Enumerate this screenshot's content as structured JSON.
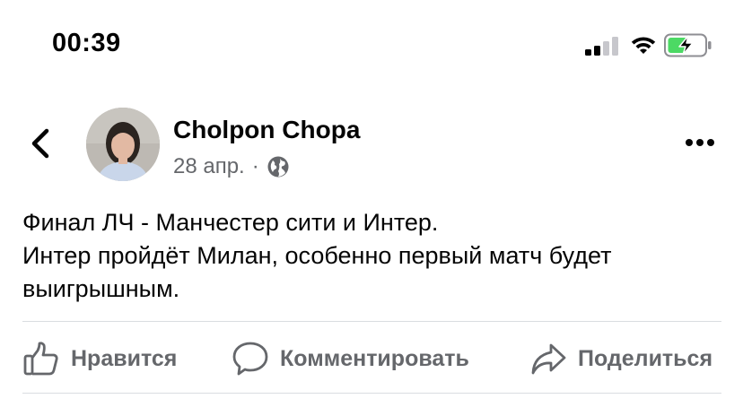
{
  "status_bar": {
    "time": "00:39",
    "signal_icon": "cellular-signal-icon",
    "wifi_icon": "wifi-icon",
    "battery_icon": "battery-charging-icon",
    "battery_color": "#4cd964"
  },
  "header": {
    "back_icon": "chevron-left-icon",
    "author_name": "Cholpon Chopa",
    "date": "28 апр.",
    "separator": "·",
    "privacy_icon": "globe-icon",
    "more_icon": "more-horizontal-icon"
  },
  "post": {
    "lines": [
      "Финал ЛЧ - Манчестер сити и Интер.",
      "Интер пройдёт Милан, особенно первый матч будет",
      "выигрышным."
    ]
  },
  "actions": {
    "like_label": "Нравится",
    "like_icon": "thumbs-up-icon",
    "comment_label": "Комментировать",
    "comment_icon": "comment-bubble-icon",
    "share_label": "Поделиться",
    "share_icon": "share-arrow-icon",
    "icon_color": "#65676b"
  }
}
